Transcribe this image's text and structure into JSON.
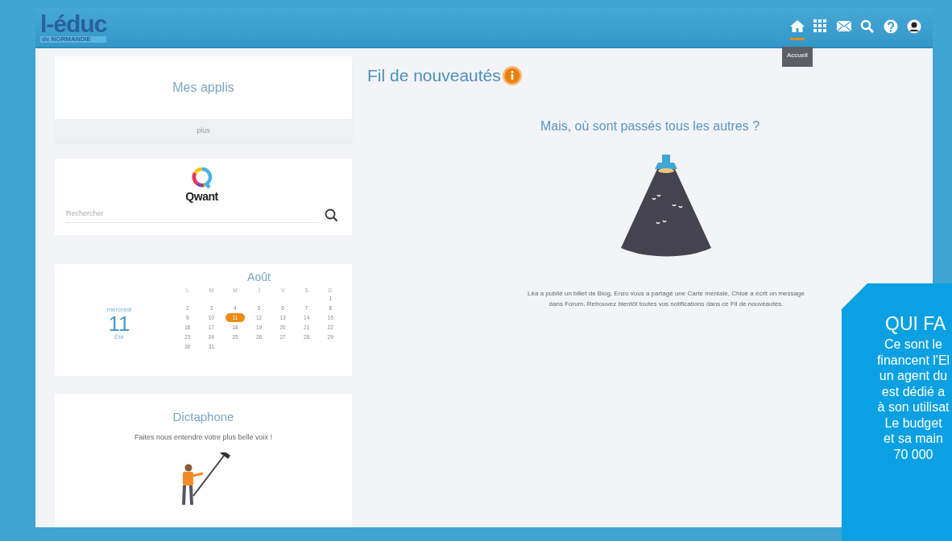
{
  "header": {
    "logo": "l-éduc",
    "logo_subtitle": "de NORMANDIE",
    "nav_icons": [
      {
        "kind": "home",
        "selected": true
      },
      {
        "kind": "grid",
        "selected": false
      },
      {
        "kind": "mail",
        "selected": false
      },
      {
        "kind": "search",
        "selected": false
      },
      {
        "kind": "help",
        "selected": false
      },
      {
        "kind": "user",
        "selected": false
      }
    ],
    "tooltip": "Accueil"
  },
  "apps_card": {
    "title": "Mes applis",
    "more": "plus"
  },
  "search_card": {
    "brand": "Qwant",
    "placeholder": "Rechercher"
  },
  "calendar": {
    "month": "Août",
    "weekday": "mercredi",
    "day": "11",
    "season": "Été",
    "day_headers": [
      "L",
      "M",
      "M",
      "J",
      "V",
      "S",
      "D"
    ],
    "weeks": [
      [
        {
          "label": "1",
          "selected": false
        }
      ],
      [
        {
          "label": "2",
          "selected": false
        },
        {
          "label": "3",
          "selected": false
        },
        {
          "label": "4",
          "selected": false
        },
        {
          "label": "5",
          "selected": false
        },
        {
          "label": "6",
          "selected": false
        },
        {
          "label": "7",
          "selected": false
        },
        {
          "label": "8",
          "selected": false
        }
      ],
      [
        {
          "label": "9",
          "selected": false
        },
        {
          "label": "10",
          "selected": false
        },
        {
          "label": "11",
          "selected": true
        },
        {
          "label": "12",
          "selected": false
        },
        {
          "label": "13",
          "selected": false
        },
        {
          "label": "14",
          "selected": false
        },
        {
          "label": "15",
          "selected": false
        }
      ],
      [
        {
          "label": "16",
          "selected": false
        },
        {
          "label": "17",
          "selected": false
        },
        {
          "label": "18",
          "selected": false
        },
        {
          "label": "19",
          "selected": false
        },
        {
          "label": "20",
          "selected": false
        },
        {
          "label": "21",
          "selected": false
        },
        {
          "label": "22",
          "selected": false
        }
      ],
      [
        {
          "label": "23",
          "selected": false
        },
        {
          "label": "24",
          "selected": false
        },
        {
          "label": "25",
          "selected": false
        },
        {
          "label": "26",
          "selected": false
        },
        {
          "label": "27",
          "selected": false
        },
        {
          "label": "28",
          "selected": false
        },
        {
          "label": "29",
          "selected": false
        }
      ],
      [
        {
          "label": "30",
          "selected": false
        },
        {
          "label": "31",
          "selected": false
        }
      ]
    ]
  },
  "dictaphone": {
    "title": "Dictaphone",
    "text": "Faites nous entendre votre plus belle voix !"
  },
  "feed": {
    "title": "Fil de nouveautés",
    "subtitle": "Mais, où sont passés tous les autres ?",
    "text": "Léa a publié un billet de Blog, Enzo vous a partagé une Carte mentale, Chloé a écrit un message dans Forum. Retrouvez bientôt toutes vos notifications dans ce Fil de nouveautés."
  },
  "callout": {
    "title": "QUI FA",
    "lines": "Ce sont le\nfinancent l'El\nun agent du\nest dédié a\nà son utilisat\nLe budget\net sa main\n70 000"
  }
}
